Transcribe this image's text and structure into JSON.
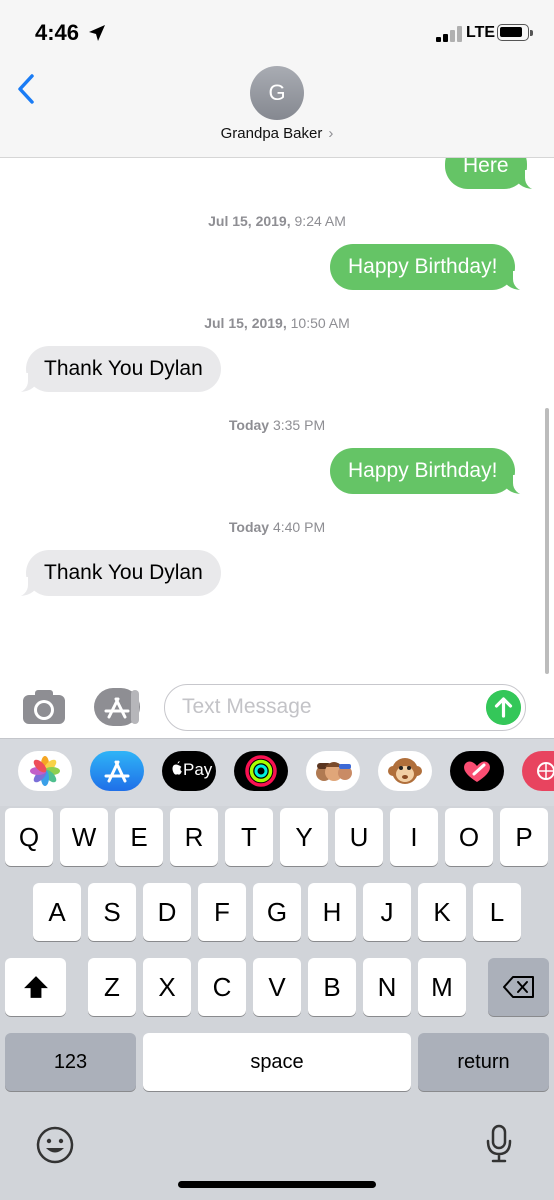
{
  "status_bar": {
    "time": "4:46",
    "network": "LTE",
    "icons": [
      "location-arrow-icon",
      "signal-icon",
      "battery-icon"
    ]
  },
  "header": {
    "avatar_initial": "G",
    "contact_name": "Grandpa Baker",
    "chevron": "›",
    "icons": [
      "back-chevron-icon"
    ]
  },
  "conversation": [
    {
      "type": "sent",
      "text": "Here"
    },
    {
      "type": "timestamp",
      "date": "Jul 15, 2019,",
      "time": "9:24 AM"
    },
    {
      "type": "sent",
      "text": "Happy Birthday!"
    },
    {
      "type": "timestamp",
      "date": "Jul 15, 2019,",
      "time": "10:50 AM"
    },
    {
      "type": "received",
      "text": "Thank You Dylan"
    },
    {
      "type": "timestamp",
      "date": "Today",
      "time": "3:35 PM"
    },
    {
      "type": "sent",
      "text": "Happy Birthday!"
    },
    {
      "type": "timestamp",
      "date": "Today",
      "time": "4:40 PM"
    },
    {
      "type": "received",
      "text": "Thank You Dylan"
    }
  ],
  "input_bar": {
    "placeholder": "Text Message",
    "value": "",
    "icons": [
      "camera-icon",
      "app-store-icon",
      "send-arrow-icon"
    ]
  },
  "app_drawer": {
    "apps": [
      "photos-icon",
      "app-store-icon",
      "apple-pay-icon",
      "activity-icon",
      "memoji-icon",
      "monkey-animoji-icon",
      "digital-touch-icon",
      "web-images-icon"
    ],
    "apple_pay_label": "Pay"
  },
  "keyboard": {
    "row1": [
      "Q",
      "W",
      "E",
      "R",
      "T",
      "Y",
      "U",
      "I",
      "O",
      "P"
    ],
    "row2": [
      "A",
      "S",
      "D",
      "F",
      "G",
      "H",
      "J",
      "K",
      "L"
    ],
    "row3": [
      "Z",
      "X",
      "C",
      "V",
      "B",
      "N",
      "M"
    ],
    "numbers_label": "123",
    "space_label": "space",
    "return_label": "return",
    "icons": [
      "shift-icon",
      "backspace-icon",
      "emoji-icon",
      "microphone-icon"
    ]
  },
  "colors": {
    "sent_bubble": "#65c466",
    "received_bubble": "#e9e9eb",
    "accent": "#1a7cf5",
    "send_button": "#34c759"
  }
}
